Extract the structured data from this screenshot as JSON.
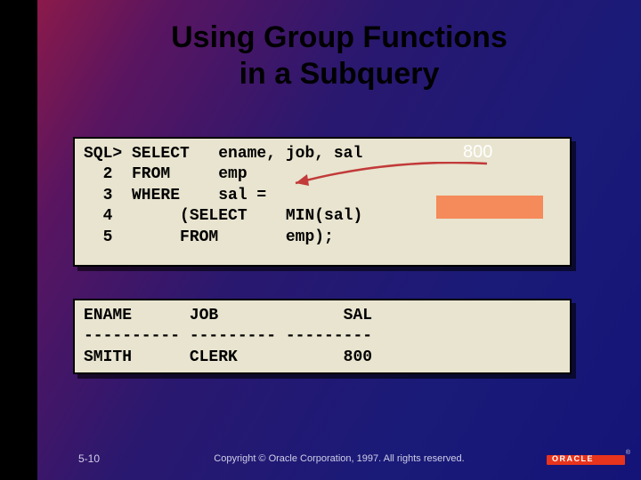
{
  "title": "Using Group Functions\nin a Subquery",
  "annotation_value": "800",
  "code_query": "SQL> SELECT   ename, job, sal\n  2  FROM     emp\n  3  WHERE    sal =\n  4       (SELECT    MIN(sal)\n  5       FROM       emp);",
  "code_result": "ENAME      JOB             SAL\n---------- --------- ---------\nSMITH      CLERK           800",
  "slide_number": "5-10",
  "copyright": "Copyright © Oracle Corporation, 1997. All rights reserved.",
  "logo_text": "ORACLE"
}
